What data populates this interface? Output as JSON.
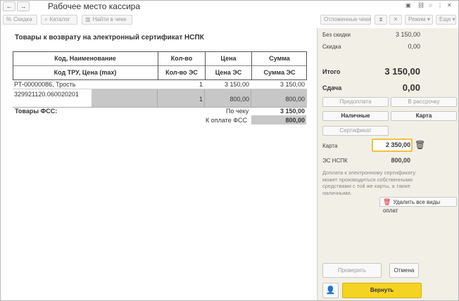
{
  "window": {
    "title": "Рабочее место кассира",
    "back_icon": "arrow-left-icon",
    "forward_icon": "arrow-right-icon"
  },
  "toolbar": {
    "discount_label": "Скидка",
    "catalog_label": "Каталог",
    "find_label": "Найти в чеке",
    "deferred_label": "Отложенные чеки",
    "mode_label": "Режим",
    "more_label": "Еще"
  },
  "main": {
    "heading": "Товары к возврату на электронный сертификат НСПК",
    "table": {
      "header1": [
        "Код, Наименование",
        "Кол-во",
        "Цена",
        "Сумма"
      ],
      "header2": [
        "Код ТРУ, Цена (max)",
        "Кол-во ЭС",
        "Цена ЭС",
        "Сумма ЭС"
      ],
      "row1": [
        "РТ-00000086, Трость",
        "1",
        "3 150,00",
        "3 150,00"
      ],
      "row2": [
        "329921120.060020201",
        "1",
        "800,00",
        "800,00"
      ]
    },
    "fss_label": "Товары ФСС:",
    "by_check_label": "По чеку",
    "by_check_value": "3 150,00",
    "to_pay_fss_label": "К оплате ФСС",
    "to_pay_fss_value": "800,00"
  },
  "panel": {
    "no_discount_label": "Без скидки",
    "no_discount_value": "3 150,00",
    "discount_label": "Скидка",
    "discount_value": "0,00",
    "total_label": "Итого",
    "total_value": "3 150,00",
    "change_label": "Сдача",
    "change_value": "0,00",
    "prepay_label": "Предоплата",
    "installment_label": "В рассрочку",
    "cash_label": "Наличные",
    "card_label": "Карта",
    "certificate_label": "Сертификат",
    "card_field_label": "Карта",
    "card_field_value": "2 350,00",
    "es_label": "ЭС НСПК",
    "es_value": "800,00",
    "note": "Доплата к электронному сертификату может производиться собственными средствами с той же карты, а также наличными.",
    "delete_all_label": "Удалить все виды оплат",
    "check_label": "Проверить",
    "cancel_label": "Отмена",
    "return_label": "Вернуть"
  },
  "colors": {
    "panel_bg": "#f1efe6",
    "return_button": "#f5d321",
    "card_input_border": "#f0c23c",
    "gray_cell": "#c7c7c7"
  }
}
